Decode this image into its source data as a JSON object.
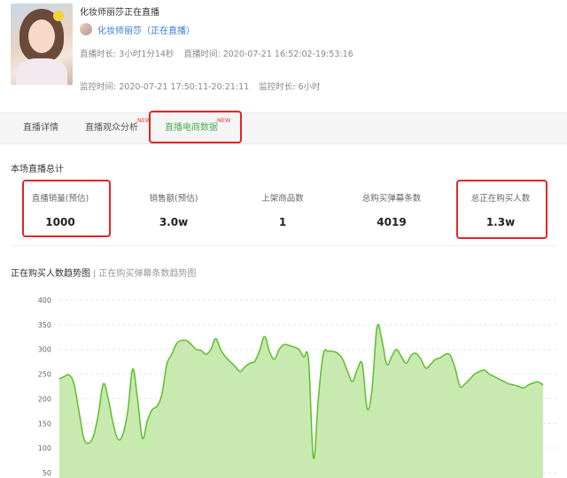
{
  "header": {
    "title": "化妆师丽莎正在直播",
    "anchor_name": "化妆师丽莎（正在直播）",
    "live_duration_label": "直播时长:",
    "live_duration_value": "3小时1分14秒",
    "live_time_label": "直播时间:",
    "live_time_value": "2020-07-21 16:52:02-19:53:16",
    "monitor_time_label": "监控时间:",
    "monitor_time_value": "2020-07-21 17:50:11-20:21:11",
    "monitor_duration_label": "监控时长:",
    "monitor_duration_value": "6小时"
  },
  "tabs": [
    {
      "label": "直播详情",
      "badge": ""
    },
    {
      "label": "直播观众分析",
      "badge": "NEW"
    },
    {
      "label": "直播电商数据",
      "badge": "NEW",
      "active": true
    }
  ],
  "summary": {
    "title": "本场直播总计",
    "stats": [
      {
        "label": "直播销量(预估)",
        "value": "1000"
      },
      {
        "label": "销售额(预估)",
        "value": "3.0w"
      },
      {
        "label": "上架商品数",
        "value": "1"
      },
      {
        "label": "总购买弹幕条数",
        "value": "4019"
      },
      {
        "label": "总正在购买人数",
        "value": "1.3w"
      }
    ]
  },
  "chart_section": {
    "title_active": "正在购买人数趋势图",
    "separator": "|",
    "title_other": "正在购买弹幕条数趋势图"
  },
  "colors": {
    "accent_green": "#4caf50",
    "area_fill": "#c8e9b0",
    "line": "#5cbf2a",
    "highlight_red": "#e3242b",
    "link_blue": "#3a7bd5"
  },
  "chart_data": {
    "type": "area",
    "title": "",
    "xlabel": "",
    "ylabel": "",
    "y_ticks": [
      50,
      100,
      150,
      200,
      250,
      300,
      350,
      400
    ],
    "ylim": [
      50,
      400
    ],
    "grid": true,
    "x": [
      0,
      1,
      2,
      3,
      4,
      5,
      6,
      7,
      8,
      9,
      10,
      11,
      12,
      13,
      14,
      15,
      16,
      17,
      18,
      19,
      20,
      21,
      22,
      23,
      24,
      25,
      26,
      27,
      28,
      29,
      30,
      31,
      32,
      33,
      34,
      35,
      36,
      37,
      38,
      39,
      40,
      41,
      42,
      43,
      44,
      45,
      46,
      47,
      48,
      49,
      50,
      51,
      52,
      53,
      54,
      55,
      56,
      57,
      58,
      59,
      60,
      61,
      62,
      63,
      64,
      65,
      66,
      67,
      68,
      69,
      70,
      71,
      72,
      73,
      74,
      75,
      76,
      77,
      78,
      79,
      80,
      81,
      82,
      83,
      84,
      85,
      86,
      87,
      88,
      89,
      90,
      91,
      92,
      93,
      94,
      95,
      96,
      97,
      98,
      99
    ],
    "values": [
      240,
      245,
      248,
      230,
      175,
      120,
      110,
      125,
      170,
      230,
      200,
      150,
      118,
      128,
      175,
      260,
      200,
      120,
      155,
      178,
      185,
      210,
      270,
      290,
      312,
      318,
      318,
      310,
      300,
      298,
      290,
      300,
      322,
      300,
      285,
      275,
      265,
      255,
      265,
      272,
      276,
      298,
      326,
      296,
      280,
      300,
      310,
      308,
      305,
      300,
      285,
      278,
      80,
      200,
      290,
      296,
      296,
      292,
      280,
      255,
      235,
      260,
      270,
      180,
      220,
      345,
      320,
      270,
      285,
      300,
      285,
      272,
      288,
      292,
      280,
      262,
      270,
      280,
      283,
      290,
      288,
      262,
      225,
      230,
      240,
      250,
      255,
      258,
      250,
      245,
      240,
      235,
      230,
      228,
      225,
      222,
      228,
      232,
      234,
      228
    ]
  }
}
